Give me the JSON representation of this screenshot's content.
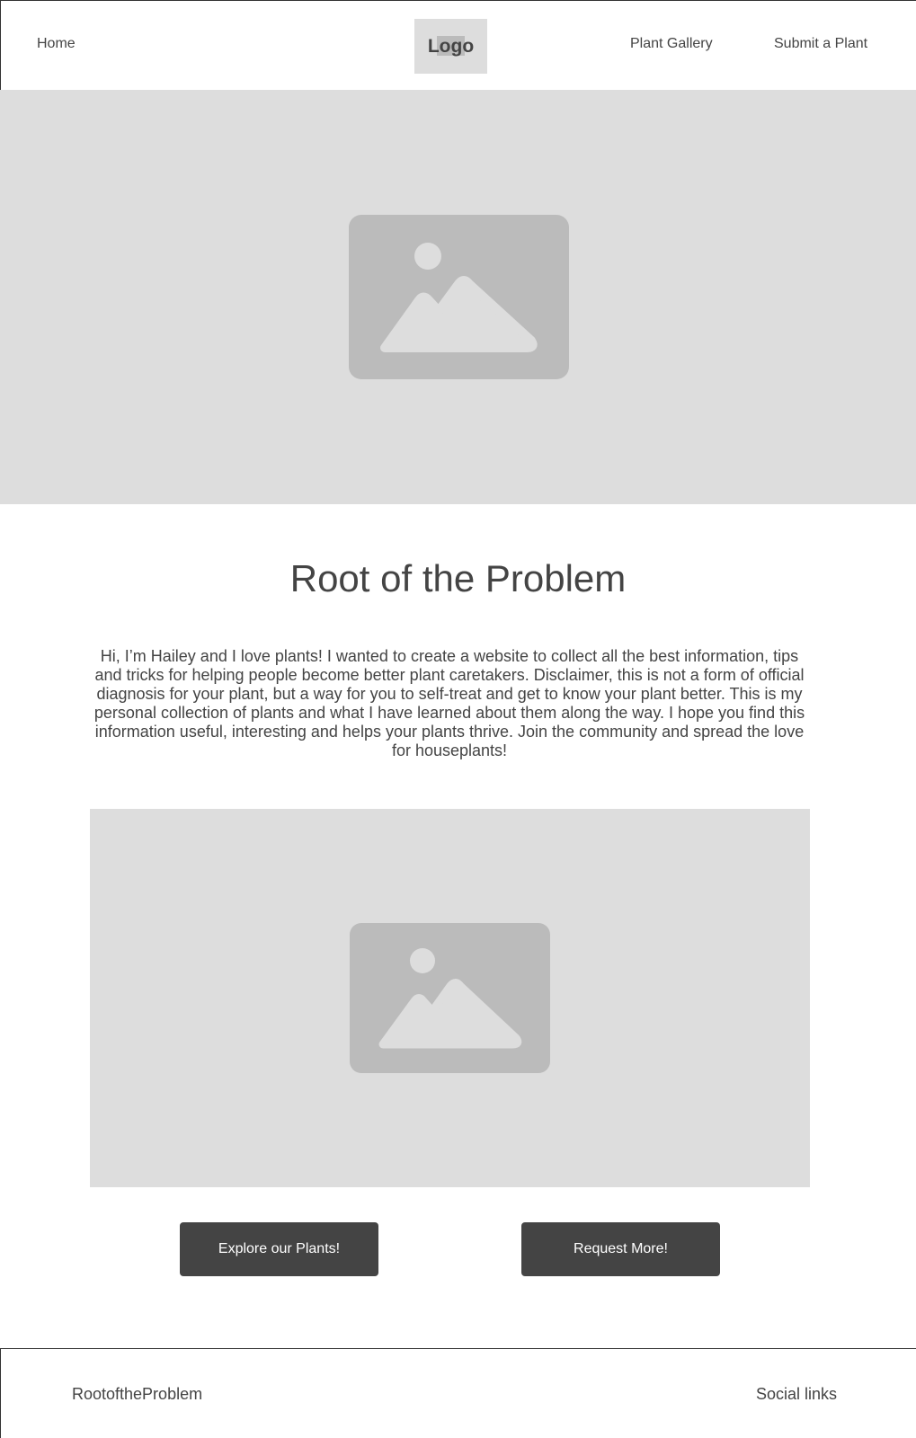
{
  "header": {
    "nav": {
      "home": "Home",
      "gallery": "Plant Gallery",
      "submit": "Submit a Plant"
    },
    "logo": "Logo"
  },
  "hero": {
    "icon": "image-placeholder-icon"
  },
  "main": {
    "title": "Root of the Problem",
    "intro": "Hi, I’m Hailey and I love plants! I wanted to create a website to collect all the best information, tips and tricks for helping people become better plant caretakers. Disclaimer, this is not a form of official diagnosis for your plant, but a way for you to self-treat and get to know your plant better. This is my personal collection of plants and what I have learned about them along the way. I hope you find this information useful, interesting and helps your plants thrive. Join the community and spread the love for houseplants!",
    "feature_icon": "image-placeholder-icon",
    "buttons": {
      "explore": "Explore our Plants!",
      "request": "Request More!"
    }
  },
  "footer": {
    "brand": "RootoftheProblem",
    "social": "Social links"
  },
  "colors": {
    "placeholder_bg": "#dddddd",
    "placeholder_icon": "#bbbbbb",
    "text": "#444444",
    "button_bg": "#444444",
    "button_text": "#ffffff"
  }
}
